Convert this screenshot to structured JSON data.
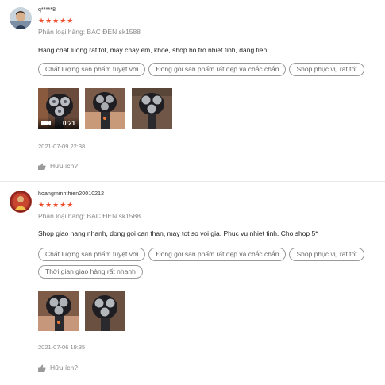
{
  "reviews": [
    {
      "author": "q*****8",
      "rating": 5,
      "stars": "★★★★★",
      "variant": "Phân loại hàng: BAC ĐEN sk1588",
      "comment": "Hang chat luong rat tot, may chay em, khoe, shop ho tro nhiet tinh, dang tien",
      "tags": [
        "Chất lượng sản phẩm tuyệt vời",
        "Đóng gói sản phẩm rất đẹp và chắc chắn",
        "Shop phục vụ rất tốt"
      ],
      "media": [
        {
          "type": "video",
          "duration": "0:21",
          "icon": "video-camera-icon"
        },
        {
          "type": "image"
        },
        {
          "type": "image"
        }
      ],
      "date": "2021-07-09 22:38",
      "helpful_label": "Hữu ích?"
    },
    {
      "author": "hoangminhthien20010212",
      "rating": 5,
      "stars": "★★★★★",
      "variant": "Phân loại hàng: BAC ĐEN sk1588",
      "comment": "Shop giao hang nhanh, dong goi can than, may tot so voi gia. Phuc vu nhiet tinh. Cho shop 5*",
      "tags": [
        "Chất lượng sản phẩm tuyệt vời",
        "Đóng gói sản phẩm rất đẹp và chắc chắn",
        "Shop phục vụ rất tốt",
        "Thời gian giao hàng rất nhanh"
      ],
      "media": [
        {
          "type": "image"
        },
        {
          "type": "image"
        }
      ],
      "date": "2021-07-06 19:35",
      "helpful_label": "Hữu ích?"
    }
  ],
  "colors": {
    "star": "#ee4d2d",
    "muted": "#8a8a8a",
    "divider": "#e8e8e8"
  }
}
